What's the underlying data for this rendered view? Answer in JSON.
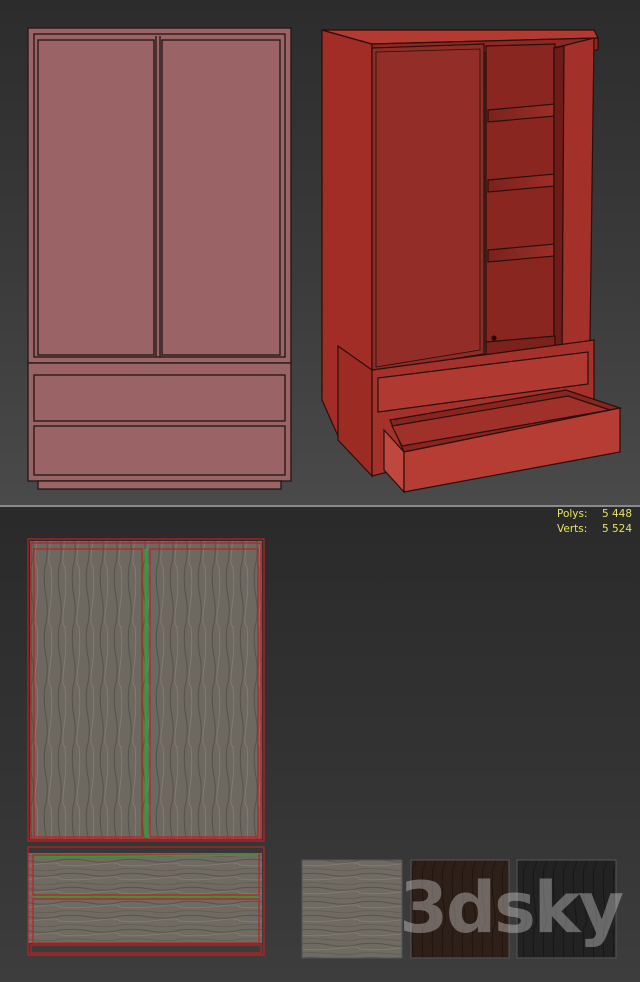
{
  "stats": {
    "polys_label": "Polys:",
    "polys_value": "5 448",
    "verts_label": "Verts:",
    "verts_value": "5 524"
  },
  "watermark": "3dsky",
  "colors": {
    "wireframe_fill": "#9a6466",
    "shaded_red": "#a5302a",
    "texture_light": "#7a746c",
    "texture_dark_brown": "#2e2019",
    "texture_black": "#1f1f1f",
    "uv_red": "#c02020",
    "uv_green": "#2fa02f",
    "stats_text": "#e8e35a"
  }
}
